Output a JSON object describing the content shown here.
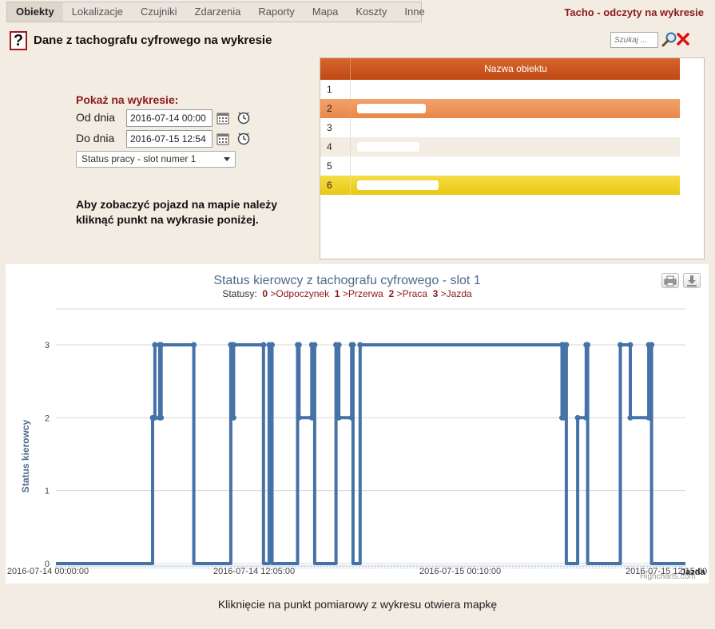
{
  "nav": {
    "items": [
      "Obiekty",
      "Lokalizacje",
      "Czujniki",
      "Zdarzenia",
      "Raporty",
      "Mapa",
      "Koszty",
      "Inne"
    ],
    "active": "Obiekty"
  },
  "app_title": "Tacho - odczyty na wykresie",
  "header": {
    "help_symbol": "?",
    "title": "Dane z tachografu cyfrowego na wykresie",
    "search_placeholder": "Szukaj ..."
  },
  "filter": {
    "title": "Pokaż na wykresie:",
    "from_label": "Od dnia",
    "from_value": "2016-07-14 00:00",
    "to_label": "Do dnia",
    "to_value": "2016-07-15 12:54",
    "slot_selected": "Status pracy - slot numer 1",
    "info": "Aby zobaczyć pojazd na mapie należy kliknąć punkt na wykrasie poniżej."
  },
  "objects": {
    "column_header": "Nazwa obiektu",
    "rows": [
      "1",
      "2",
      "3",
      "4",
      "5",
      "6"
    ],
    "selected_row": "2",
    "highlighted_row": "6"
  },
  "chart_data": {
    "type": "line",
    "title": "Status kierowcy z tachografu cyfrowego - slot 1",
    "subtitle": {
      "prefix": "Statusy:",
      "statuses": [
        {
          "code": "0",
          "name": "Odpoczynek"
        },
        {
          "code": "1",
          "name": "Przerwa"
        },
        {
          "code": "2",
          "name": "Praca"
        },
        {
          "code": "3",
          "name": "Jazda"
        }
      ]
    },
    "ylabel": "Status kierowcy",
    "ylim": [
      0,
      3
    ],
    "yticks": [
      0,
      1,
      2,
      3
    ],
    "xlim": [
      "2016-07-14 00:00:00",
      "2016-07-15 12:54:00"
    ],
    "xticks": [
      "2016-07-14 00:00:00",
      "2016-07-14 12:05:00",
      "2016-07-15 00:10:00",
      "2016-07-15 12:15:00"
    ],
    "last_point_label": "Jazda",
    "grid": true,
    "legend": "none",
    "color": "#4572a7",
    "series": [
      {
        "x": [
          "2016-07-14 00:00",
          "2016-07-14 05:40",
          "2016-07-14 05:40",
          "2016-07-14 05:48",
          "2016-07-14 05:48",
          "2016-07-14 06:05",
          "2016-07-14 06:05",
          "2016-07-14 06:10",
          "2016-07-14 06:10",
          "2016-07-14 08:05",
          "2016-07-14 08:05",
          "2016-07-14 10:15",
          "2016-07-14 10:15",
          "2016-07-14 10:20",
          "2016-07-14 10:20",
          "2016-07-14 10:25",
          "2016-07-14 10:25",
          "2016-07-14 12:10",
          "2016-07-14 12:10",
          "2016-07-14 12:30",
          "2016-07-14 12:30",
          "2016-07-14 12:40",
          "2016-07-14 12:40",
          "2016-07-14 14:10",
          "2016-07-14 14:10",
          "2016-07-14 14:15",
          "2016-07-14 14:15",
          "2016-07-14 15:00",
          "2016-07-14 15:00",
          "2016-07-14 15:10",
          "2016-07-14 15:10",
          "2016-07-14 16:25",
          "2016-07-14 16:25",
          "2016-07-14 16:35",
          "2016-07-14 16:35",
          "2016-07-14 17:20",
          "2016-07-14 17:20",
          "2016-07-14 17:25",
          "2016-07-14 17:25",
          "2016-07-14 17:50",
          "2016-07-14 17:50",
          "2016-07-15 05:40",
          "2016-07-15 05:40",
          "2016-07-15 05:45",
          "2016-07-15 05:45",
          "2016-07-15 05:55",
          "2016-07-15 05:55",
          "2016-07-15 06:35",
          "2016-07-15 06:35",
          "2016-07-15 07:05",
          "2016-07-15 07:05",
          "2016-07-15 07:10",
          "2016-07-15 07:10",
          "2016-07-15 09:05",
          "2016-07-15 09:05",
          "2016-07-15 09:40",
          "2016-07-15 09:40",
          "2016-07-15 10:45",
          "2016-07-15 10:45",
          "2016-07-15 10:55",
          "2016-07-15 10:55",
          "2016-07-15 12:54"
        ],
        "y": [
          0,
          0,
          2,
          2,
          3,
          3,
          2,
          2,
          3,
          3,
          0,
          0,
          3,
          3,
          2,
          2,
          3,
          3,
          0,
          0,
          3,
          3,
          0,
          0,
          3,
          3,
          2,
          2,
          3,
          3,
          0,
          0,
          3,
          3,
          2,
          2,
          3,
          3,
          0,
          0,
          3,
          3,
          2,
          2,
          3,
          3,
          0,
          0,
          2,
          2,
          3,
          3,
          0,
          0,
          3,
          3,
          2,
          2,
          3,
          3,
          0,
          0
        ]
      }
    ]
  },
  "footer": "Kliknięcie na punkt pomiarowy z wykresu otwiera mapkę"
}
